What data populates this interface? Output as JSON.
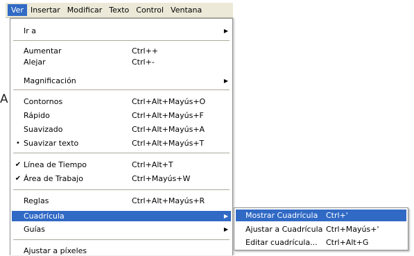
{
  "menubar": {
    "items": [
      "Ver",
      "Insertar",
      "Modificar",
      "Texto",
      "Control",
      "Ventana"
    ]
  },
  "side_letter": "A",
  "main_menu": {
    "ira": {
      "label": "Ir a"
    },
    "aumentar": {
      "label": "Aumentar",
      "shortcut": "Ctrl++"
    },
    "alejar": {
      "label": "Alejar",
      "shortcut": "Ctrl+-"
    },
    "magnificacion": {
      "label": "Magnificación"
    },
    "contornos": {
      "label": "Contornos",
      "shortcut": "Ctrl+Alt+Mayús+O"
    },
    "rapido": {
      "label": "Rápido",
      "shortcut": "Ctrl+Alt+Mayús+F"
    },
    "suavizado": {
      "label": "Suavizado",
      "shortcut": "Ctrl+Alt+Mayús+A"
    },
    "suavizar_texto": {
      "label": "Suavizar texto",
      "shortcut": "Ctrl+Alt+Mayús+T"
    },
    "linea_tiempo": {
      "label": "Línea de Tiempo",
      "shortcut": "Ctrl+Alt+T"
    },
    "area_trabajo": {
      "label": "Área de Trabajo",
      "shortcut": "Ctrl+Mayús+W"
    },
    "reglas": {
      "label": "Reglas",
      "shortcut": "Ctrl+Alt+Mayús+R"
    },
    "cuadricula": {
      "label": "Cuadrícula"
    },
    "guias": {
      "label": "Guías"
    },
    "ajustar_pixeles": {
      "label": "Ajustar a píxeles"
    }
  },
  "glyphs": {
    "arrow": "▶",
    "dot": "•",
    "check": "✔"
  },
  "sub_menu": {
    "mostrar": {
      "label": "Mostrar Cuadrícula",
      "shortcut": "Ctrl+'"
    },
    "ajustar": {
      "label": "Ajustar a Cuadrícula",
      "shortcut": "Ctrl+Mayús+'"
    },
    "editar": {
      "label": "Editar cuadrícula...",
      "shortcut": "Ctrl+Alt+G"
    }
  },
  "colors": {
    "highlight": "#316ac5",
    "menubar_bg": "#ece9d8"
  }
}
